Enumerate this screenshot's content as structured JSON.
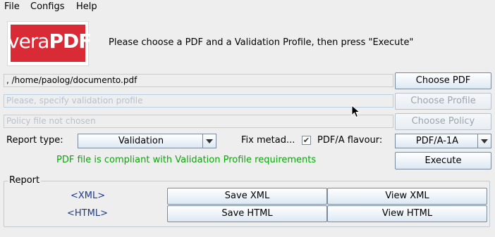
{
  "menu": {
    "items": [
      "File",
      "Configs",
      "Help"
    ]
  },
  "logo": {
    "part1": "vera",
    "part2": "PDF"
  },
  "instruction": "Please choose a PDF and a Validation Profile, then press \"Execute\"",
  "fields": {
    "pdf_path": ", /home/paolog/documento.pdf",
    "profile_placeholder": "Please, specify validation profile",
    "policy_placeholder": "Policy file not chosen"
  },
  "buttons": {
    "choose_pdf": "Choose PDF",
    "choose_profile": "Choose Profile",
    "choose_policy": "Choose Policy",
    "execute": "Execute",
    "save_xml": "Save XML",
    "view_xml": "View XML",
    "save_html": "Save HTML",
    "view_html": "View HTML"
  },
  "report_type": {
    "label": "Report type:",
    "value": "Validation"
  },
  "fix_metadata": {
    "label": "Fix metad...",
    "checked": true,
    "check_glyph": "✔"
  },
  "flavour": {
    "label": "PDF/A flavour:",
    "value": "PDF/A-1A"
  },
  "status": "PDF file is compliant with Validation Profile requirements",
  "report": {
    "legend": "Report",
    "xml_link": "<XML>",
    "html_link": "<HTML>"
  },
  "colors": {
    "accent_red": "#d92b35",
    "status_green": "#0aa60a",
    "link_blue": "#1e3a8a"
  }
}
